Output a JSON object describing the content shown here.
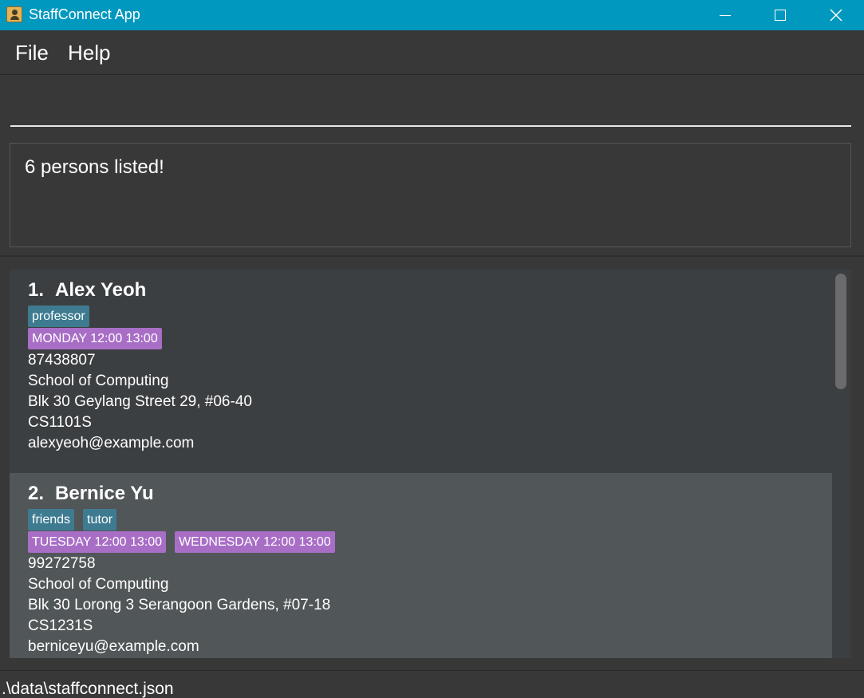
{
  "window": {
    "title": "StaffConnect App"
  },
  "menu": {
    "file": "File",
    "help": "Help"
  },
  "command": {
    "value": "",
    "placeholder": ""
  },
  "result": {
    "text": "6 persons listed!"
  },
  "persons": [
    {
      "index": "1.",
      "name": "Alex Yeoh",
      "tags": [
        "professor"
      ],
      "availability": [
        "MONDAY 12:00 13:00"
      ],
      "phone": "87438807",
      "faculty": "School of Computing",
      "venue": "Blk 30 Geylang Street 29, #06-40",
      "module": "CS1101S",
      "email": "alexyeoh@example.com"
    },
    {
      "index": "2.",
      "name": "Bernice Yu",
      "tags": [
        "friends",
        "tutor"
      ],
      "availability": [
        "TUESDAY 12:00 13:00",
        "WEDNESDAY 12:00 13:00"
      ],
      "phone": "99272758",
      "faculty": "School of Computing",
      "venue": "Blk 30 Lorong 3 Serangoon Gardens, #07-18",
      "module": "CS1231S",
      "email": "berniceyu@example.com"
    }
  ],
  "status": {
    "path": ".\\data\\staffconnect.json"
  },
  "colors": {
    "titlebar": "#0198bf",
    "background": "#383838",
    "card_odd": "#3c3f41",
    "card_even": "#515658",
    "tag": "#3e7b91",
    "availability": "#a86ec6"
  },
  "icons": {
    "app": "contact-book-icon",
    "minimize": "minimize-icon",
    "maximize": "maximize-icon",
    "close": "close-icon"
  }
}
